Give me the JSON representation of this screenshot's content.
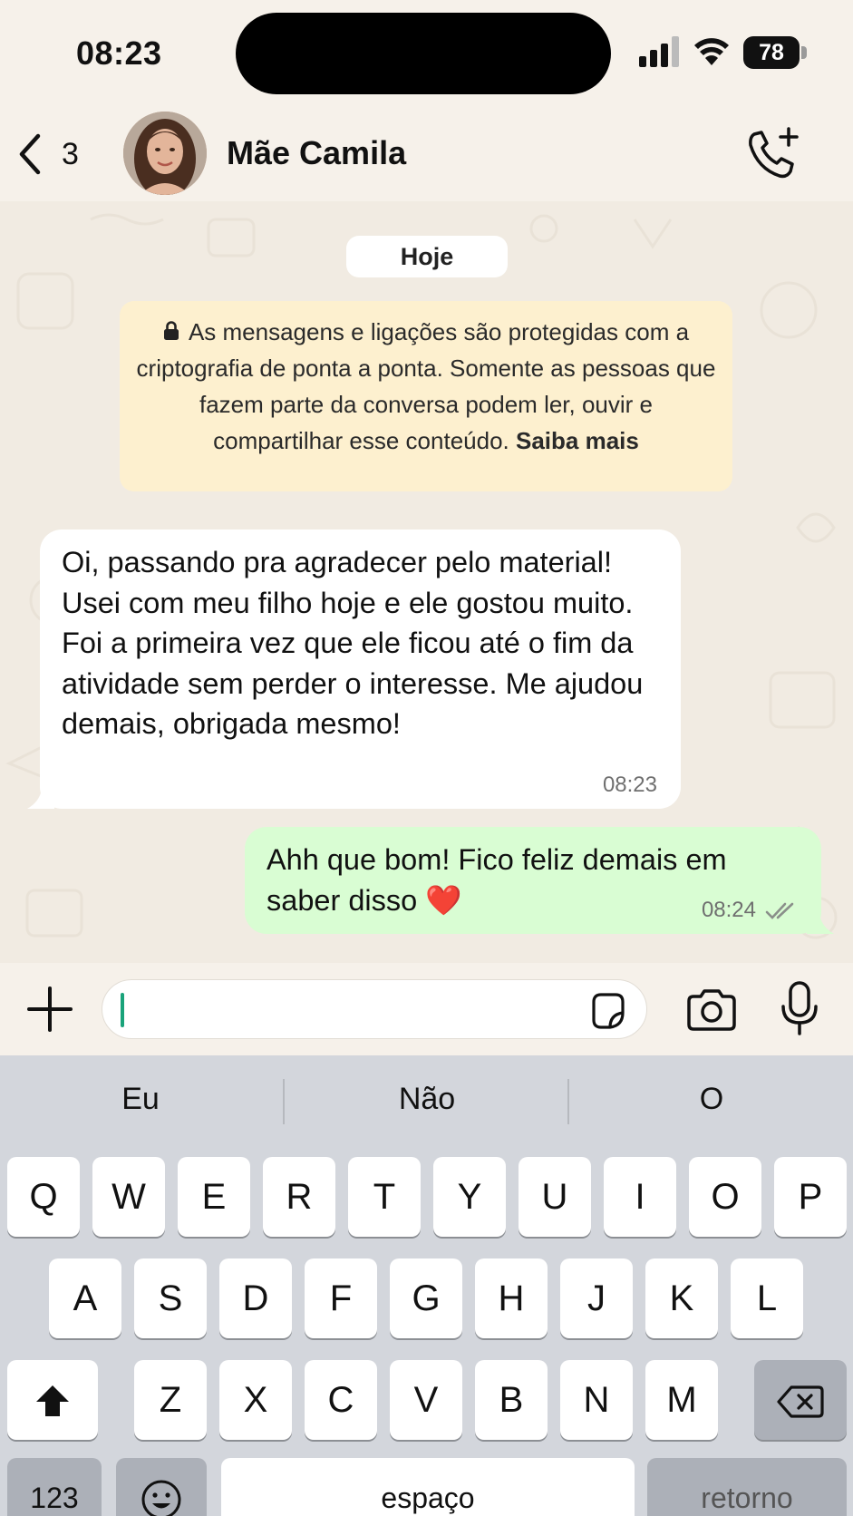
{
  "status_bar": {
    "time": "08:23",
    "battery": "78"
  },
  "header": {
    "back_count": "3",
    "contact_name": "Mãe Camila"
  },
  "chat": {
    "date_label": "Hoje",
    "encryption_notice": {
      "text": "As mensagens e ligações são protegidas com a criptografia de ponta a ponta. Somente as pessoas que fazem parte da conversa podem ler, ouvir e compartilhar esse conteúdo.",
      "link": "Saiba mais"
    },
    "messages": [
      {
        "direction": "incoming",
        "text": "Oi, passando pra agradecer pelo material! Usei com meu filho hoje e ele gostou muito. Foi a primeira vez que ele ficou até o fim da atividade sem perder o interesse. Me ajudou demais, obrigada mesmo!",
        "time": "08:23"
      },
      {
        "direction": "outgoing",
        "text": "Ahh que bom! Fico feliz demais em saber disso",
        "emoji": "❤️",
        "time": "08:24",
        "status": "delivered"
      }
    ]
  },
  "input": {
    "value": ""
  },
  "keyboard": {
    "suggestions": [
      "Eu",
      "Não",
      "O"
    ],
    "rows": [
      [
        "Q",
        "W",
        "E",
        "R",
        "T",
        "Y",
        "U",
        "I",
        "O",
        "P"
      ],
      [
        "A",
        "S",
        "D",
        "F",
        "G",
        "H",
        "J",
        "K",
        "L"
      ],
      [
        "Z",
        "X",
        "C",
        "V",
        "B",
        "N",
        "M"
      ]
    ],
    "numbers_key": "123",
    "space_key": "espaço",
    "return_key": "retorno"
  },
  "colors": {
    "incoming_bubble": "#ffffff",
    "outgoing_bubble": "#d9fdd3",
    "notice_bg": "#fdf0cf",
    "caret": "#1aa37a",
    "chat_bg": "#f1ebe2"
  }
}
